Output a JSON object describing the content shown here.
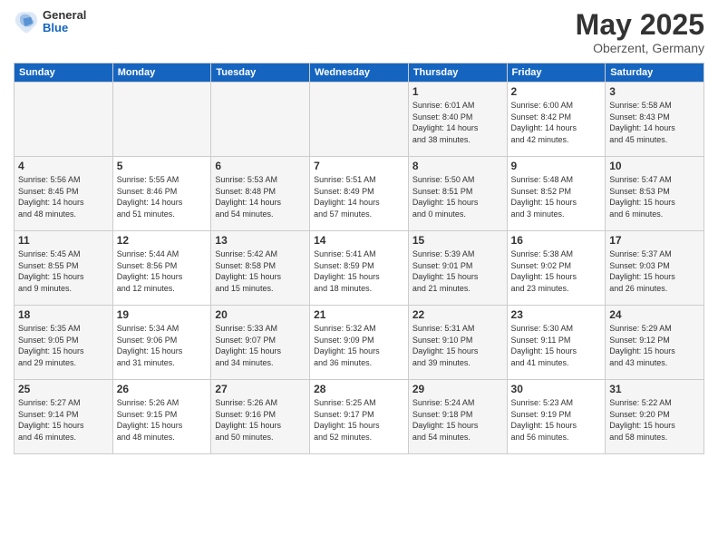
{
  "header": {
    "logo": {
      "general": "General",
      "blue": "Blue"
    },
    "title": "May 2025",
    "location": "Oberzent, Germany"
  },
  "weekdays": [
    "Sunday",
    "Monday",
    "Tuesday",
    "Wednesday",
    "Thursday",
    "Friday",
    "Saturday"
  ],
  "weeks": [
    {
      "days": [
        {
          "num": "",
          "info": ""
        },
        {
          "num": "",
          "info": ""
        },
        {
          "num": "",
          "info": ""
        },
        {
          "num": "",
          "info": ""
        },
        {
          "num": "1",
          "sunrise": "6:01 AM",
          "sunset": "8:40 PM",
          "daylight": "14 hours and 38 minutes."
        },
        {
          "num": "2",
          "sunrise": "6:00 AM",
          "sunset": "8:42 PM",
          "daylight": "14 hours and 42 minutes."
        },
        {
          "num": "3",
          "sunrise": "5:58 AM",
          "sunset": "8:43 PM",
          "daylight": "14 hours and 45 minutes."
        }
      ]
    },
    {
      "days": [
        {
          "num": "4",
          "sunrise": "5:56 AM",
          "sunset": "8:45 PM",
          "daylight": "14 hours and 48 minutes."
        },
        {
          "num": "5",
          "sunrise": "5:55 AM",
          "sunset": "8:46 PM",
          "daylight": "14 hours and 51 minutes."
        },
        {
          "num": "6",
          "sunrise": "5:53 AM",
          "sunset": "8:48 PM",
          "daylight": "14 hours and 54 minutes."
        },
        {
          "num": "7",
          "sunrise": "5:51 AM",
          "sunset": "8:49 PM",
          "daylight": "14 hours and 57 minutes."
        },
        {
          "num": "8",
          "sunrise": "5:50 AM",
          "sunset": "8:51 PM",
          "daylight": "15 hours and 0 minutes."
        },
        {
          "num": "9",
          "sunrise": "5:48 AM",
          "sunset": "8:52 PM",
          "daylight": "15 hours and 3 minutes."
        },
        {
          "num": "10",
          "sunrise": "5:47 AM",
          "sunset": "8:53 PM",
          "daylight": "15 hours and 6 minutes."
        }
      ]
    },
    {
      "days": [
        {
          "num": "11",
          "sunrise": "5:45 AM",
          "sunset": "8:55 PM",
          "daylight": "15 hours and 9 minutes."
        },
        {
          "num": "12",
          "sunrise": "5:44 AM",
          "sunset": "8:56 PM",
          "daylight": "15 hours and 12 minutes."
        },
        {
          "num": "13",
          "sunrise": "5:42 AM",
          "sunset": "8:58 PM",
          "daylight": "15 hours and 15 minutes."
        },
        {
          "num": "14",
          "sunrise": "5:41 AM",
          "sunset": "8:59 PM",
          "daylight": "15 hours and 18 minutes."
        },
        {
          "num": "15",
          "sunrise": "5:39 AM",
          "sunset": "9:01 PM",
          "daylight": "15 hours and 21 minutes."
        },
        {
          "num": "16",
          "sunrise": "5:38 AM",
          "sunset": "9:02 PM",
          "daylight": "15 hours and 23 minutes."
        },
        {
          "num": "17",
          "sunrise": "5:37 AM",
          "sunset": "9:03 PM",
          "daylight": "15 hours and 26 minutes."
        }
      ]
    },
    {
      "days": [
        {
          "num": "18",
          "sunrise": "5:35 AM",
          "sunset": "9:05 PM",
          "daylight": "15 hours and 29 minutes."
        },
        {
          "num": "19",
          "sunrise": "5:34 AM",
          "sunset": "9:06 PM",
          "daylight": "15 hours and 31 minutes."
        },
        {
          "num": "20",
          "sunrise": "5:33 AM",
          "sunset": "9:07 PM",
          "daylight": "15 hours and 34 minutes."
        },
        {
          "num": "21",
          "sunrise": "5:32 AM",
          "sunset": "9:09 PM",
          "daylight": "15 hours and 36 minutes."
        },
        {
          "num": "22",
          "sunrise": "5:31 AM",
          "sunset": "9:10 PM",
          "daylight": "15 hours and 39 minutes."
        },
        {
          "num": "23",
          "sunrise": "5:30 AM",
          "sunset": "9:11 PM",
          "daylight": "15 hours and 41 minutes."
        },
        {
          "num": "24",
          "sunrise": "5:29 AM",
          "sunset": "9:12 PM",
          "daylight": "15 hours and 43 minutes."
        }
      ]
    },
    {
      "days": [
        {
          "num": "25",
          "sunrise": "5:27 AM",
          "sunset": "9:14 PM",
          "daylight": "15 hours and 46 minutes."
        },
        {
          "num": "26",
          "sunrise": "5:26 AM",
          "sunset": "9:15 PM",
          "daylight": "15 hours and 48 minutes."
        },
        {
          "num": "27",
          "sunrise": "5:26 AM",
          "sunset": "9:16 PM",
          "daylight": "15 hours and 50 minutes."
        },
        {
          "num": "28",
          "sunrise": "5:25 AM",
          "sunset": "9:17 PM",
          "daylight": "15 hours and 52 minutes."
        },
        {
          "num": "29",
          "sunrise": "5:24 AM",
          "sunset": "9:18 PM",
          "daylight": "15 hours and 54 minutes."
        },
        {
          "num": "30",
          "sunrise": "5:23 AM",
          "sunset": "9:19 PM",
          "daylight": "15 hours and 56 minutes."
        },
        {
          "num": "31",
          "sunrise": "5:22 AM",
          "sunset": "9:20 PM",
          "daylight": "15 hours and 58 minutes."
        }
      ]
    }
  ],
  "labels": {
    "sunrise": "Sunrise:",
    "sunset": "Sunset:",
    "daylight": "Daylight:"
  }
}
